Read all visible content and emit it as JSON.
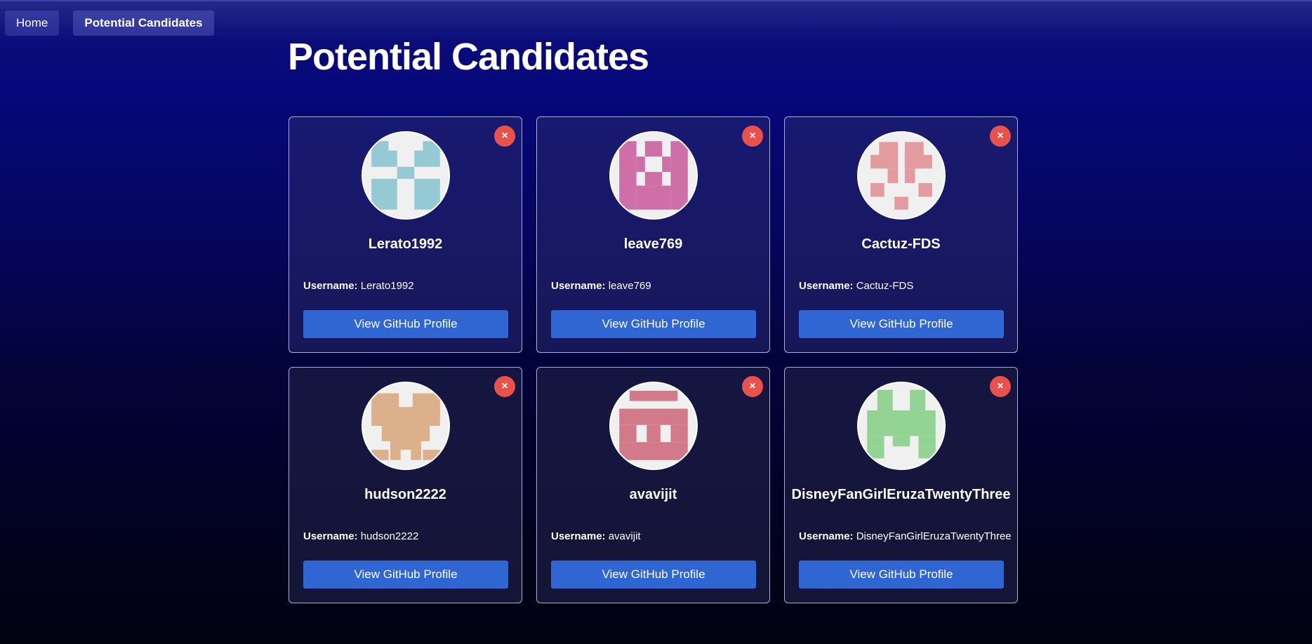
{
  "nav": {
    "items": [
      {
        "label": "Home",
        "active": false
      },
      {
        "label": "Potential Candidates",
        "active": true
      }
    ]
  },
  "page": {
    "title": "Potential Candidates"
  },
  "labels": {
    "username_label": "Username:",
    "github_button": "View GitHub Profile",
    "close_symbol": "×"
  },
  "candidates": [
    {
      "name": "Lerato1992",
      "username": "Lerato1992",
      "avatar_color": "#95c9d4",
      "avatar_icon": "identicon-avatar"
    },
    {
      "name": "leave769",
      "username": "leave769",
      "avatar_color": "#cf6fa8",
      "avatar_icon": "identicon-avatar"
    },
    {
      "name": "Cactuz-FDS",
      "username": "Cactuz-FDS",
      "avatar_color": "#e39ba0",
      "avatar_icon": "identicon-avatar"
    },
    {
      "name": "hudson2222",
      "username": "hudson2222",
      "avatar_color": "#dcb08a",
      "avatar_icon": "identicon-avatar"
    },
    {
      "name": "avavijit",
      "username": "avavijit",
      "avatar_color": "#d27a8a",
      "avatar_icon": "identicon-avatar"
    },
    {
      "name": "DisneyFanGirlEruzaTwentyThree",
      "username": "DisneyFanGirlEruzaTwentyThree",
      "avatar_color": "#93d495",
      "avatar_icon": "identicon-avatar"
    }
  ],
  "colors": {
    "accent_button": "#2f66d4",
    "close_button": "#e9524a",
    "avatar_background": "#f0f0f0"
  }
}
